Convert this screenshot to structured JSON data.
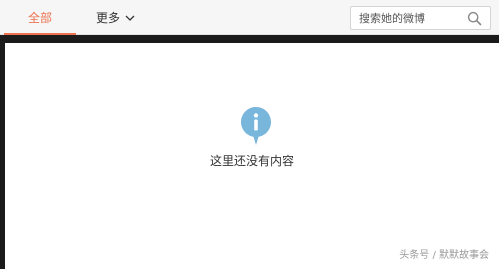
{
  "tabs": {
    "all_label": "全部",
    "more_label": "更多"
  },
  "search": {
    "placeholder": "搜索她的微博"
  },
  "empty_state": {
    "message": "这里还没有内容"
  },
  "watermark": {
    "text": "头条号 / 默默故事会"
  },
  "colors": {
    "accent": "#eb7350",
    "info_icon": "#79b6dc"
  },
  "icons": {
    "more_dropdown": "chevron-down-icon",
    "search": "search-icon",
    "empty_state": "info-icon"
  }
}
